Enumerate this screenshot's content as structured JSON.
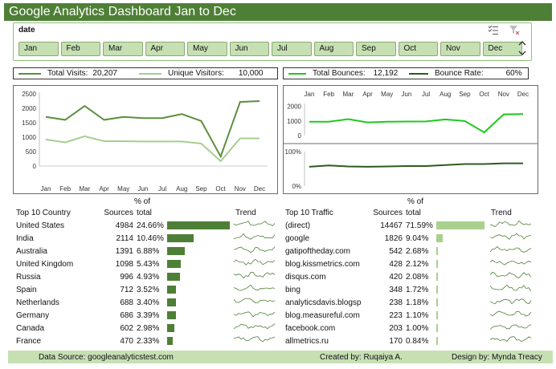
{
  "title": "Google Analytics Dashboard Jan to Dec",
  "slicer": {
    "header": "date",
    "months": [
      "Jan",
      "Feb",
      "Mar",
      "Apr",
      "May",
      "Jun",
      "Jul",
      "Aug",
      "Sep",
      "Oct",
      "Nov",
      "Dec"
    ],
    "icons": [
      "multi-select-icon",
      "clear-filter-icon",
      "scroll-up-icon",
      "scroll-down-icon"
    ]
  },
  "kpis": {
    "total_visits_label": "Total Visits:",
    "total_visits_value": "20,207",
    "unique_visitors_label": "Unique Visitors:",
    "unique_visitors_value": "10,000",
    "total_bounces_label": "Total Bounces:",
    "total_bounces_value": "12,192",
    "bounce_rate_label": "Bounce Rate:",
    "bounce_rate_value": "60%"
  },
  "colors": {
    "header_green": "#4e7f36",
    "light_green_fill": "#c6e0b4",
    "visits_line": "#5b8f3c",
    "unique_line": "#a5cf8e",
    "bounce_line": "#1ec81e",
    "bounce_rate_line": "#2e5a22",
    "bar_country": "#4e7f36",
    "bar_traffic": "#a9d18e"
  },
  "chart_data": [
    {
      "type": "line",
      "categories": [
        "Jan",
        "Feb",
        "Mar",
        "Apr",
        "May",
        "Jun",
        "Jul",
        "Aug",
        "Sep",
        "Oct",
        "Nov",
        "Dec"
      ],
      "series": [
        {
          "name": "Total Visits",
          "values": [
            1700,
            1600,
            2080,
            1600,
            1700,
            1660,
            1660,
            1800,
            1560,
            330,
            2220,
            2250
          ]
        },
        {
          "name": "Unique Visitors",
          "values": [
            920,
            820,
            1030,
            860,
            860,
            850,
            850,
            850,
            780,
            170,
            960,
            960
          ]
        }
      ],
      "yticks": [
        "0",
        "500",
        "1000",
        "1500",
        "2000",
        "2500"
      ],
      "ylim": [
        0,
        2500
      ],
      "grid": false
    },
    {
      "type": "line",
      "categories": [
        "Jan",
        "Feb",
        "Mar",
        "Apr",
        "May",
        "Jun",
        "Jul",
        "Aug",
        "Sep",
        "Oct",
        "Nov",
        "Dec"
      ],
      "series": [
        {
          "name": "Total Bounces",
          "values": [
            950,
            950,
            1130,
            900,
            950,
            960,
            970,
            1110,
            1000,
            220,
            1450,
            1480
          ]
        }
      ],
      "yticks": [
        "0",
        "1000",
        "2000"
      ],
      "ylim": [
        0,
        2200
      ],
      "grid": false
    },
    {
      "type": "line",
      "categories": [
        "Jan",
        "Feb",
        "Mar",
        "Apr",
        "May",
        "Jun",
        "Jul",
        "Aug",
        "Sep",
        "Oct",
        "Nov",
        "Dec"
      ],
      "series": [
        {
          "name": "Bounce Rate",
          "values": [
            0.56,
            0.6,
            0.57,
            0.56,
            0.57,
            0.58,
            0.58,
            0.61,
            0.64,
            0.64,
            0.66,
            0.66
          ]
        }
      ],
      "yticks": [
        "0%",
        "100%"
      ],
      "ylim": [
        0,
        1
      ],
      "grid": false
    }
  ],
  "country_table": {
    "pct_header_top": "% of",
    "headers": [
      "Top 10 Country",
      "Sources",
      "total",
      "Trend"
    ],
    "rows": [
      {
        "name": "United States",
        "sources": "4984",
        "pct": "24.66%",
        "share": 0.2466
      },
      {
        "name": "India",
        "sources": "2114",
        "pct": "10.46%",
        "share": 0.1046
      },
      {
        "name": "Australia",
        "sources": "1391",
        "pct": "6.88%",
        "share": 0.0688
      },
      {
        "name": "United Kingdom",
        "sources": "1098",
        "pct": "5.43%",
        "share": 0.0543
      },
      {
        "name": "Russia",
        "sources": "996",
        "pct": "4.93%",
        "share": 0.0493
      },
      {
        "name": "Spain",
        "sources": "712",
        "pct": "3.52%",
        "share": 0.0352
      },
      {
        "name": "Netherlands",
        "sources": "688",
        "pct": "3.40%",
        "share": 0.034
      },
      {
        "name": "Germany",
        "sources": "686",
        "pct": "3.39%",
        "share": 0.0339
      },
      {
        "name": "Canada",
        "sources": "602",
        "pct": "2.98%",
        "share": 0.0298
      },
      {
        "name": "France",
        "sources": "470",
        "pct": "2.33%",
        "share": 0.0233
      }
    ]
  },
  "traffic_table": {
    "pct_header_top": "% of",
    "headers": [
      "Top 10 Traffic",
      "Sources",
      "total",
      "Trend"
    ],
    "rows": [
      {
        "name": "(direct)",
        "sources": "14467",
        "pct": "71.59%",
        "share": 0.7159
      },
      {
        "name": "google",
        "sources": "1826",
        "pct": "9.04%",
        "share": 0.0904
      },
      {
        "name": "gatipoftheday.com",
        "sources": "542",
        "pct": "2.68%",
        "share": 0.0268
      },
      {
        "name": "blog.kissmetrics.com",
        "sources": "428",
        "pct": "2.12%",
        "share": 0.0212
      },
      {
        "name": "disqus.com",
        "sources": "420",
        "pct": "2.08%",
        "share": 0.0208
      },
      {
        "name": "bing",
        "sources": "348",
        "pct": "1.72%",
        "share": 0.0172
      },
      {
        "name": "analyticsdavis.blogsp",
        "sources": "238",
        "pct": "1.18%",
        "share": 0.0118
      },
      {
        "name": "blog.measureful.com",
        "sources": "223",
        "pct": "1.10%",
        "share": 0.011
      },
      {
        "name": "facebook.com",
        "sources": "203",
        "pct": "1.00%",
        "share": 0.01
      },
      {
        "name": "allmetrics.ru",
        "sources": "170",
        "pct": "0.84%",
        "share": 0.0084
      }
    ]
  },
  "footer": {
    "data_source": "Data Source:  googleanalyticstest.com",
    "created_by": "Created by:  Ruqaiya A.",
    "design_by": "Design by:  Mynda Treacy"
  }
}
